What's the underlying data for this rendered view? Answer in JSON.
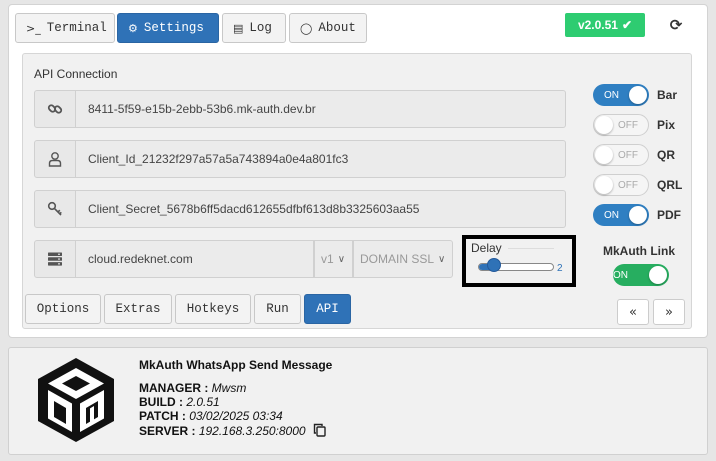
{
  "tabs": [
    {
      "label": "Terminal",
      "icon": "terminal-icon",
      "glyph": ">_"
    },
    {
      "label": "Settings",
      "icon": "gears-icon",
      "glyph": "⚙"
    },
    {
      "label": "Log",
      "icon": "list-icon",
      "glyph": "▤"
    },
    {
      "label": "About",
      "icon": "comment-icon",
      "glyph": "◯"
    }
  ],
  "version": {
    "label": "v2.0.51",
    "check": "✔",
    "color": "#2ecc71"
  },
  "refresh_glyph": "⟳",
  "api": {
    "title": "API Connection",
    "url": "8411-5f59-e15b-2ebb-53b6.mk-auth.dev.br",
    "client_id": "Client_Id_21232f297a57a5a743894a0e4a801fc3",
    "client_secret": "Client_Secret_5678b6ff5dacd612655dfbf613d8b3325603aa55",
    "server": "cloud.redeknet.com",
    "api_version": "v1",
    "ssl_mode": "DOMAIN SSL",
    "chevron": "∨"
  },
  "delay": {
    "label": "Delay",
    "value": "2",
    "fraction": 0.15
  },
  "toggles": [
    {
      "name": "Bar",
      "state": "ON",
      "on": true
    },
    {
      "name": "Pix",
      "state": "OFF",
      "on": false
    },
    {
      "name": "QR",
      "state": "OFF",
      "on": false
    },
    {
      "name": "QRL",
      "state": "OFF",
      "on": false
    },
    {
      "name": "PDF",
      "state": "ON",
      "on": true
    }
  ],
  "mkauth_link": {
    "label": "MkAuth Link",
    "state": "ON"
  },
  "bottom_tabs": [
    "Options",
    "Extras",
    "Hotkeys",
    "Run",
    "API"
  ],
  "pager": {
    "prev": "«",
    "next": "»"
  },
  "about": {
    "title": "MkAuth WhatsApp Send Message",
    "manager_label": "MANAGER :",
    "manager": "Mwsm",
    "build_label": "BUILD :",
    "build": "2.0.51",
    "patch_label": "PATCH :",
    "patch": "03/02/2025 03:34",
    "server_label": "SERVER :",
    "server": "192.168.3.250:8000"
  },
  "colors": {
    "accent": "#2f72b7",
    "success": "#2ecc71",
    "toggle_on": "#2f7fc2",
    "link_on": "#27ae60"
  }
}
